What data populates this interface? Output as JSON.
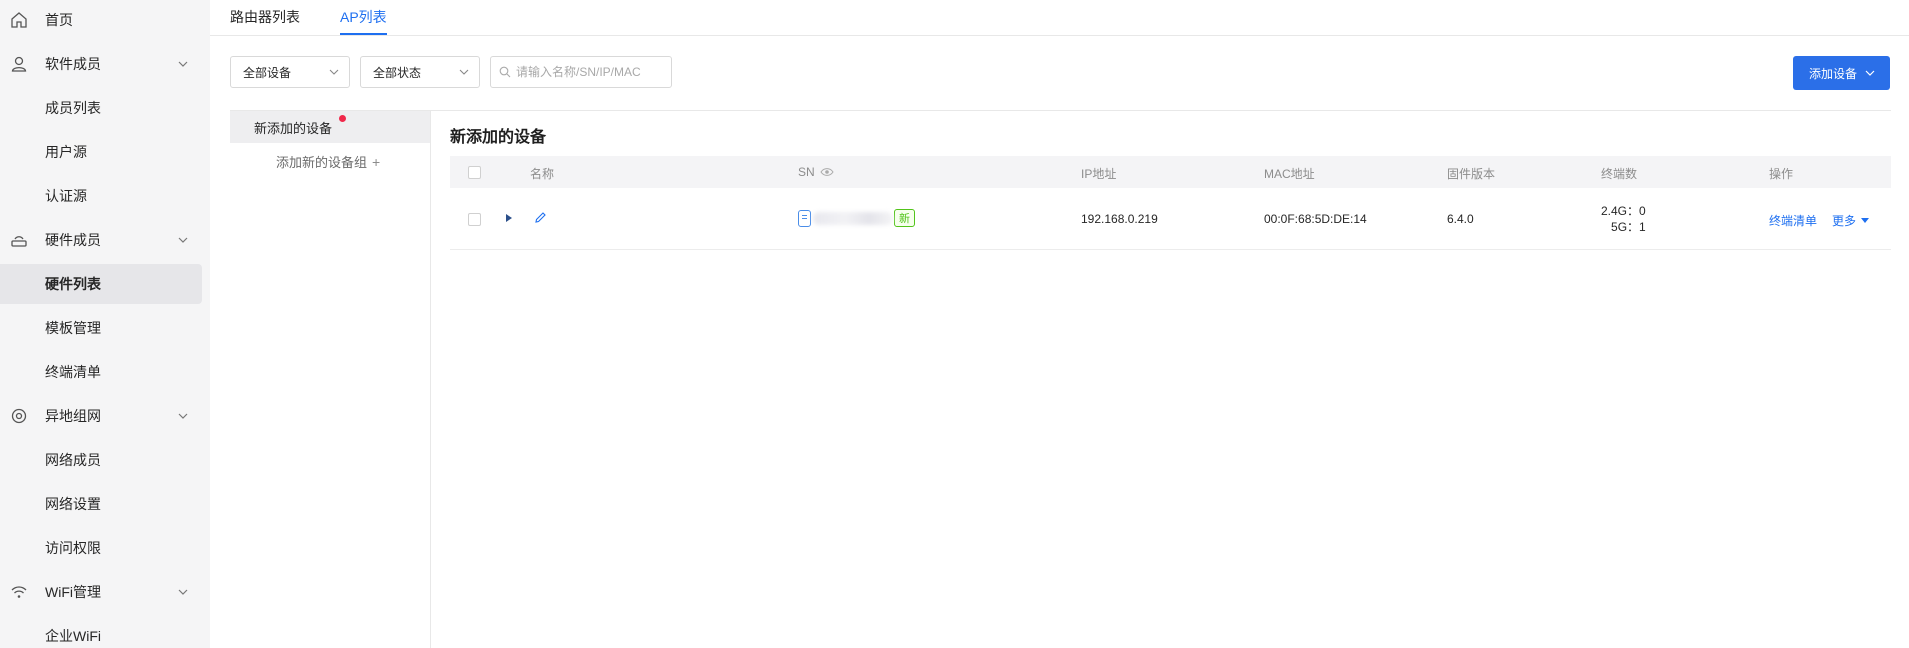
{
  "sidebar": {
    "items": [
      {
        "label": "首页",
        "icon": "home-icon",
        "type": "top"
      },
      {
        "label": "软件成员",
        "icon": "user-icon",
        "type": "group"
      },
      {
        "label": "成员列表",
        "type": "sub"
      },
      {
        "label": "用户源",
        "type": "sub"
      },
      {
        "label": "认证源",
        "type": "sub"
      },
      {
        "label": "硬件成员",
        "icon": "router-icon",
        "type": "group"
      },
      {
        "label": "硬件列表",
        "type": "sub",
        "active": true
      },
      {
        "label": "模板管理",
        "type": "sub"
      },
      {
        "label": "终端清单",
        "type": "sub"
      },
      {
        "label": "异地组网",
        "icon": "network-icon",
        "type": "group"
      },
      {
        "label": "网络成员",
        "type": "sub"
      },
      {
        "label": "网络设置",
        "type": "sub"
      },
      {
        "label": "访问权限",
        "type": "sub"
      },
      {
        "label": "WiFi管理",
        "icon": "wifi-icon",
        "type": "group"
      },
      {
        "label": "企业WiFi",
        "type": "sub"
      }
    ]
  },
  "tabs": [
    {
      "label": "路由器列表",
      "active": false
    },
    {
      "label": "AP列表",
      "active": true
    }
  ],
  "toolbar": {
    "device_filter": "全部设备",
    "status_filter": "全部状态",
    "search_placeholder": "请输入名称/SN/IP/MAC",
    "add_button": "添加设备"
  },
  "groups": {
    "selected": "新添加的设备",
    "add_label": "添加新的设备组"
  },
  "main": {
    "title": "新添加的设备",
    "columns": [
      "名称",
      "SN",
      "IP地址",
      "MAC地址",
      "固件版本",
      "终端数",
      "操作"
    ],
    "rows": [
      {
        "sn_badge": "新",
        "ip": "192.168.0.219",
        "mac": "00:0F:68:5D:DE:14",
        "firmware": "6.4.0",
        "terminals_24g": "2.4G：0",
        "terminals_5g": "5G：1",
        "action_terminals": "终端清单",
        "action_more": "更多"
      }
    ]
  },
  "colors": {
    "accent": "#1e6ff0",
    "button": "#2b6fe8",
    "new_badge": "#52c41a",
    "dot": "#f0284a"
  }
}
